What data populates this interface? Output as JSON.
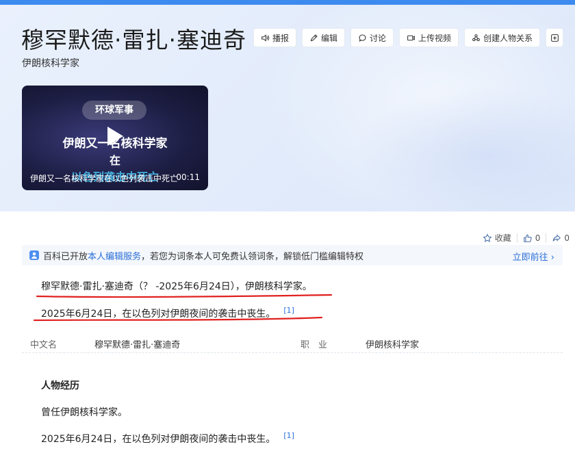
{
  "header": {
    "title": "穆罕默德·雷扎·塞迪奇",
    "subtitle": "伊朗核科学家",
    "actions": [
      {
        "label": "播报",
        "icon": "speaker-icon"
      },
      {
        "label": "编辑",
        "icon": "pencil-icon"
      },
      {
        "label": "讨论",
        "icon": "chat-bubble-icon"
      },
      {
        "label": "上传视频",
        "icon": "video-camera-icon"
      },
      {
        "label": "创建人物关系",
        "icon": "people-icon"
      },
      {
        "label": "",
        "icon": "plus-icon"
      }
    ]
  },
  "video": {
    "tag": "环球军事",
    "headline_line1": "伊朗又一名核科学家",
    "headline_line2": "在",
    "headline_line3": "以色列袭击中死亡",
    "caption": "伊朗又一名核科学家在以色列袭击中死亡",
    "duration": "00:11"
  },
  "stats": {
    "favorite_label": "收藏",
    "like_count": "0",
    "share_count": "0"
  },
  "notice": {
    "text_before": "百科已开放",
    "link_text": "本人编辑服务",
    "text_after": "，若您为词条本人可免费认领词条，解锁低门槛编辑特权",
    "goto_label": "立即前往 ›"
  },
  "summary": {
    "line1": "穆罕默德·雷扎·塞迪奇（？ -2025年6月24日），伊朗核科学家。",
    "line2": "2025年6月24日，在以色列对伊朗夜间的袭击中丧生。",
    "line2_ref": "[1]"
  },
  "infobox": {
    "items": [
      {
        "key": "中文名",
        "value": "穆罕默德·雷扎·塞迪奇"
      },
      {
        "key": "职　业",
        "value": "伊朗核科学家"
      }
    ]
  },
  "section": {
    "heading": "人物经历",
    "para1": "曾任伊朗核科学家。",
    "para2": "2025年6月24日，在以色列对伊朗夜间的袭击中丧生。",
    "para2_ref": "[1]"
  },
  "colors": {
    "accent": "#2a6fd6",
    "topbar": "#3e8bf0",
    "annotation_red": "#e0201e"
  }
}
